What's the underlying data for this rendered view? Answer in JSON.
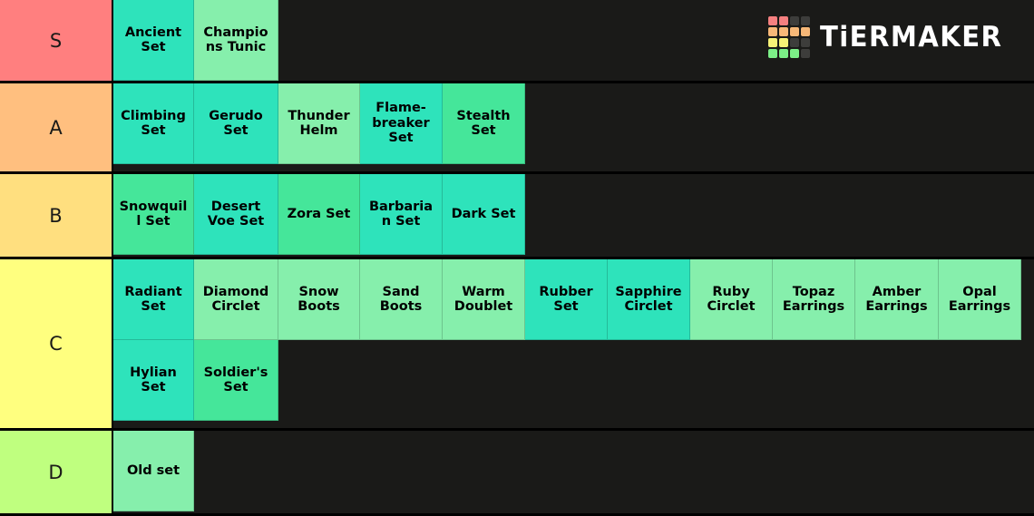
{
  "logo": {
    "brand_text": "TiERMAKER",
    "grid_colors": [
      "#f58080",
      "#f58080",
      "#3d3d3b",
      "#3d3d3b",
      "#f7b878",
      "#f7b878",
      "#f7b878",
      "#f7b878",
      "#f7f277",
      "#f7f277",
      "#3d3d3b",
      "#3d3d3b",
      "#7cef87",
      "#7cef87",
      "#7cef87",
      "#3d3d3b"
    ]
  },
  "palette": {
    "background": "#1a1a18",
    "divider": "#000000",
    "tier_s": "#ff7f7f",
    "tier_a": "#ffbf7f",
    "tier_b": "#ffdf7f",
    "tier_c": "#ffff7f",
    "tier_d": "#bfff7f",
    "item_turquoise": "#2ee3bb",
    "item_green": "#45e69a",
    "item_mint": "#86efac"
  },
  "tiers": [
    {
      "label": "S",
      "color": "#ff7f7f",
      "height": 89,
      "items": [
        {
          "label": "Ancient Set",
          "color": "#2ee3bb",
          "width": 89
        },
        {
          "label": "Champions Tunic",
          "color": "#86efac",
          "width": 93
        }
      ]
    },
    {
      "label": "A",
      "color": "#ffbf7f",
      "height": 97,
      "items": [
        {
          "label": "Climbing Set",
          "color": "#2ee3bb",
          "width": 89
        },
        {
          "label": "Gerudo Set",
          "color": "#2ee3bb",
          "width": 93
        },
        {
          "label": "Thunder Helm",
          "color": "#86efac",
          "width": 90
        },
        {
          "label": "Flame-breaker Set",
          "color": "#2ee3bb",
          "width": 91
        },
        {
          "label": "Stealth Set",
          "color": "#45e69a",
          "width": 91
        }
      ]
    },
    {
      "label": "B",
      "color": "#ffdf7f",
      "height": 91,
      "items": [
        {
          "label": "Snowquill Set",
          "color": "#45e69a",
          "width": 89
        },
        {
          "label": "Desert Voe Set",
          "color": "#2ee3bb",
          "width": 93
        },
        {
          "label": "Zora Set",
          "color": "#45e69a",
          "width": 90
        },
        {
          "label": "Barbarian Set",
          "color": "#2ee3bb",
          "width": 91
        },
        {
          "label": "Dark Set",
          "color": "#2ee3bb",
          "width": 91
        }
      ]
    },
    {
      "label": "C",
      "color": "#ffff7f",
      "height": 186,
      "items": [
        {
          "label": "Radiant Set",
          "color": "#2ee3bb",
          "width": 89
        },
        {
          "label": "Diamond Circlet",
          "color": "#86efac",
          "width": 93
        },
        {
          "label": "Snow Boots",
          "color": "#86efac",
          "width": 90
        },
        {
          "label": "Sand Boots",
          "color": "#86efac",
          "width": 91
        },
        {
          "label": "Warm Doublet",
          "color": "#86efac",
          "width": 91
        },
        {
          "label": "Rubber Set",
          "color": "#2ee3bb",
          "width": 91
        },
        {
          "label": "Sapphire Circlet",
          "color": "#2ee3bb",
          "width": 91
        },
        {
          "label": "Ruby Circlet",
          "color": "#86efac",
          "width": 91
        },
        {
          "label": "Topaz Earrings",
          "color": "#86efac",
          "width": 91
        },
        {
          "label": "Amber Earrings",
          "color": "#86efac",
          "width": 92
        },
        {
          "label": "Opal Earrings",
          "color": "#86efac",
          "width": 91
        },
        {
          "label": "Hylian Set",
          "color": "#2ee3bb",
          "width": 89
        },
        {
          "label": "Soldier's Set",
          "color": "#45e69a",
          "width": 93
        }
      ]
    },
    {
      "label": "D",
      "color": "#bfff7f",
      "height": 91,
      "items": [
        {
          "label": "Old set",
          "color": "#86efac",
          "width": 89
        }
      ]
    }
  ]
}
